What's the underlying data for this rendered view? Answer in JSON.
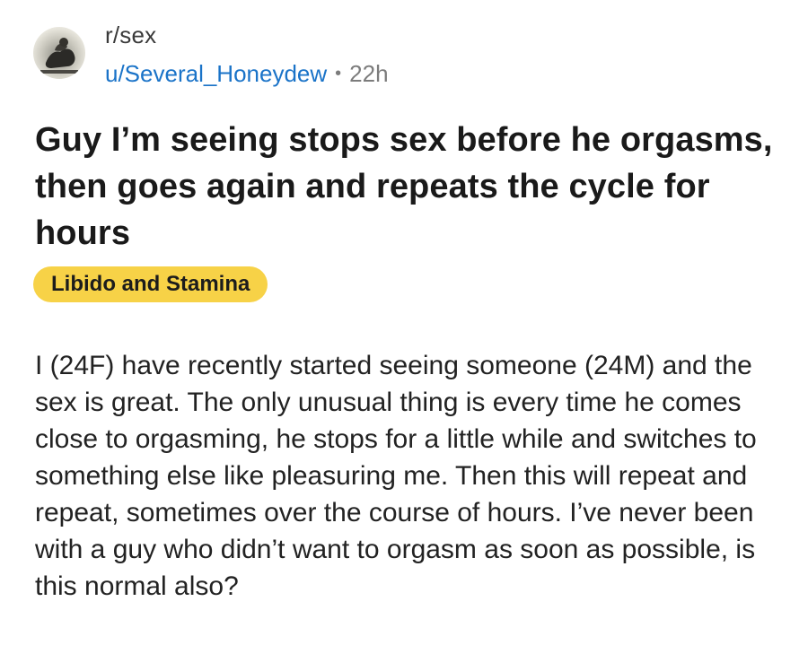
{
  "post": {
    "subreddit": "r/sex",
    "username": "u/Several_Honeydew",
    "separator": "•",
    "age": "22h",
    "title": "Guy I’m seeing stops sex before he orgasms, then goes again and repeats the cycle for hours",
    "flair": "Libido and Stamina",
    "flair_color": "#f7d247",
    "body": "I (24F) have recently started seeing someone (24M) and the sex is great. The only unusual thing is every time he comes close to orgasming, he stops for a little while and switches to something else like pleasuring me. Then this will repeat and repeat, sometimes over the course of hours. I’ve never been with a guy who didn’t want to orgasm as soon as possible, is this normal also?"
  },
  "colors": {
    "username": "#1a73c8",
    "muted": "#7c7c7c"
  },
  "icons": {
    "avatar": "subreddit-avatar-statue"
  }
}
